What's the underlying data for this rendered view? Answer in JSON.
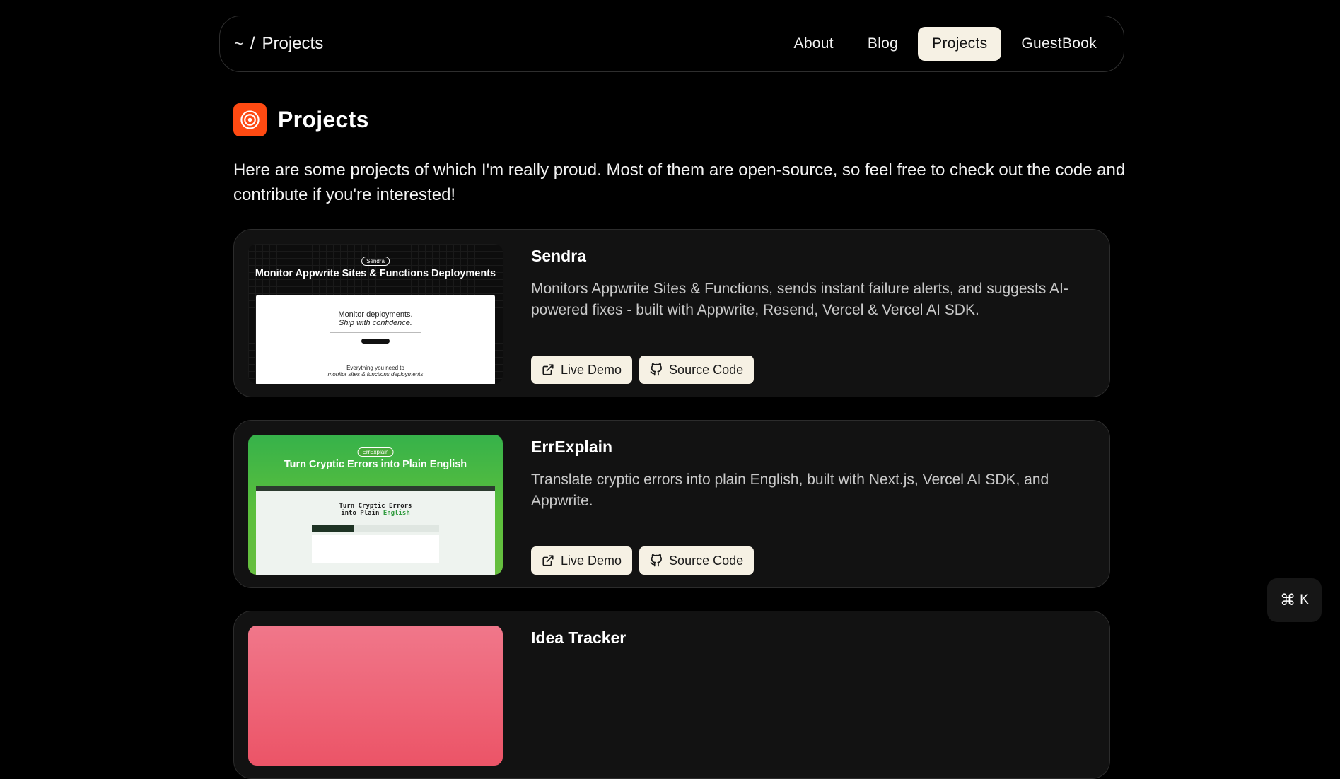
{
  "header": {
    "breadcrumb_home": "~",
    "breadcrumb_sep": "/",
    "breadcrumb_current": "Projects",
    "nav": [
      "About",
      "Blog",
      "Projects",
      "GuestBook"
    ],
    "active_nav": "Projects"
  },
  "page": {
    "title": "Projects",
    "intro": "Here are some projects of which I'm really proud. Most of them are open-source, so feel free to check out the code and contribute if you're interested!"
  },
  "projects": [
    {
      "name": "Sendra",
      "description": "Monitors Appwrite Sites & Functions, sends instant failure alerts, and suggests AI-powered fixes - built with Appwrite, Resend, Vercel & Vercel AI SDK.",
      "thumb_badge": "Sendra",
      "thumb_title": "Monitor Appwrite Sites & Functions Deployments",
      "thumb_line1": "Monitor deployments.",
      "thumb_line2": "Ship with confidence.",
      "thumb_line3": "Everything you need to",
      "thumb_line4": "monitor sites & functions deployments",
      "live_label": "Live Demo",
      "source_label": "Source Code"
    },
    {
      "name": "ErrExplain",
      "description": "Translate cryptic errors into plain English, built with Next.js, Vercel AI SDK, and Appwrite.",
      "thumb_badge": "ErrExplain",
      "thumb_title": "Turn Cryptic Errors into Plain English",
      "thumb_line1": "Turn Cryptic Errors",
      "thumb_line2a": "into Plain ",
      "thumb_line2b": "English",
      "live_label": "Live Demo",
      "source_label": "Source Code"
    },
    {
      "name": "Idea Tracker"
    }
  ],
  "command_palette": {
    "symbol": "⌘",
    "key": "K"
  },
  "colors": {
    "accent_orange": "#ff4a12",
    "button_bg": "#f6f1e4",
    "card_bg": "#121212"
  }
}
